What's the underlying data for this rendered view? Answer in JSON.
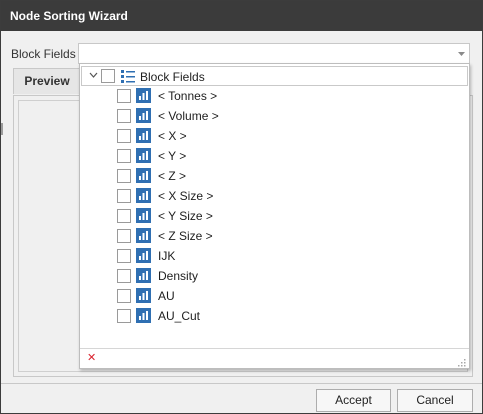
{
  "window": {
    "title": "Node Sorting Wizard"
  },
  "form": {
    "block_fields_label": "Block Fields",
    "block_fields_value": ""
  },
  "tabs": [
    {
      "label": "Preview"
    }
  ],
  "dropdown": {
    "root": {
      "label": "Block Fields",
      "checked": false,
      "expanded": true
    },
    "items": [
      {
        "label": "< Tonnes >",
        "checked": false
      },
      {
        "label": "< Volume >",
        "checked": false
      },
      {
        "label": "< X >",
        "checked": false
      },
      {
        "label": "< Y >",
        "checked": false
      },
      {
        "label": "< Z >",
        "checked": false
      },
      {
        "label": "< X Size >",
        "checked": false
      },
      {
        "label": "< Y Size >",
        "checked": false
      },
      {
        "label": "< Z Size >",
        "checked": false
      },
      {
        "label": "IJK",
        "checked": false
      },
      {
        "label": "Density",
        "checked": false
      },
      {
        "label": "AU",
        "checked": false
      },
      {
        "label": "AU_Cut",
        "checked": false
      }
    ],
    "clear_glyph": "✕"
  },
  "buttons": {
    "accept": "Accept",
    "cancel": "Cancel"
  },
  "colors": {
    "titlebar": "#3b3b3b",
    "field_icon": "#2f6fb2",
    "clear": "#d9232e"
  }
}
